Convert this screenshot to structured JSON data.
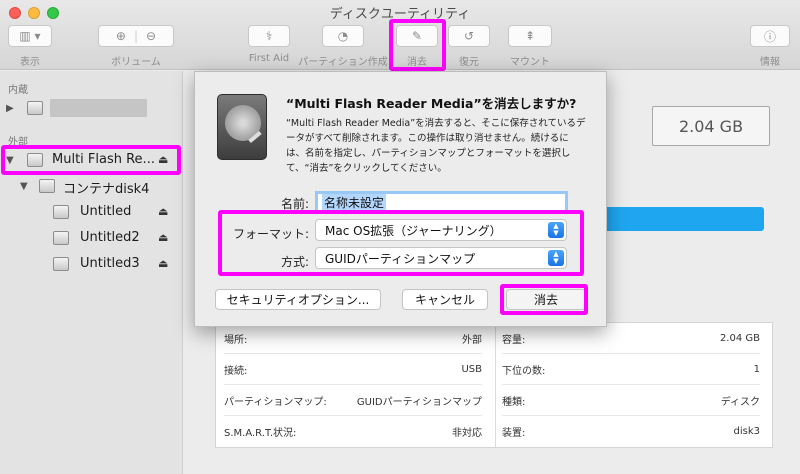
{
  "window": {
    "title": "ディスクユーティリティ"
  },
  "toolbar": {
    "view_label": "表示",
    "volume_label": "ボリューム",
    "firstaid_label": "First Aid",
    "partition_label": "パーティション作成",
    "erase_label": "消去",
    "restore_label": "復元",
    "mount_label": "マウント",
    "info_label": "情報"
  },
  "sidebar": {
    "internal_header": "内蔵",
    "external_header": "外部",
    "items": [
      {
        "label": "Multi Flash Re..."
      },
      {
        "label": "コンテナdisk4"
      },
      {
        "label": "Untitled"
      },
      {
        "label": "Untitled2"
      },
      {
        "label": "Untitled3"
      }
    ]
  },
  "main": {
    "capacity": "2.04 GB"
  },
  "dialog": {
    "title": "“Multi Flash Reader Media”を消去しますか?",
    "body": "“Multi Flash Reader Media”を消去すると、そこに保存されているデータがすべて削除されます。この操作は取り消せません。続けるには、名前を指定し、パーティションマップとフォーマットを選択して、“消去”をクリックしてください。",
    "name_label": "名前:",
    "name_value": "名称未設定",
    "format_label": "フォーマット:",
    "format_value": "Mac OS拡張（ジャーナリング）",
    "scheme_label": "方式:",
    "scheme_value": "GUIDパーティションマップ",
    "security_button": "セキュリティオプション...",
    "cancel_button": "キャンセル",
    "erase_button": "消去"
  },
  "info": {
    "left": [
      {
        "key": "場所:",
        "value": "外部"
      },
      {
        "key": "接続:",
        "value": "USB"
      },
      {
        "key": "パーティションマップ:",
        "value": "GUIDパーティションマップ"
      },
      {
        "key": "S.M.A.R.T.状況:",
        "value": "非対応"
      }
    ],
    "right": [
      {
        "key": "容量:",
        "value": "2.04 GB"
      },
      {
        "key": "下位の数:",
        "value": "1"
      },
      {
        "key": "種類:",
        "value": "ディスク"
      },
      {
        "key": "装置:",
        "value": "disk3"
      }
    ]
  },
  "colors": {
    "highlight": "#ff00ff",
    "accent": "#1fa6f0"
  }
}
